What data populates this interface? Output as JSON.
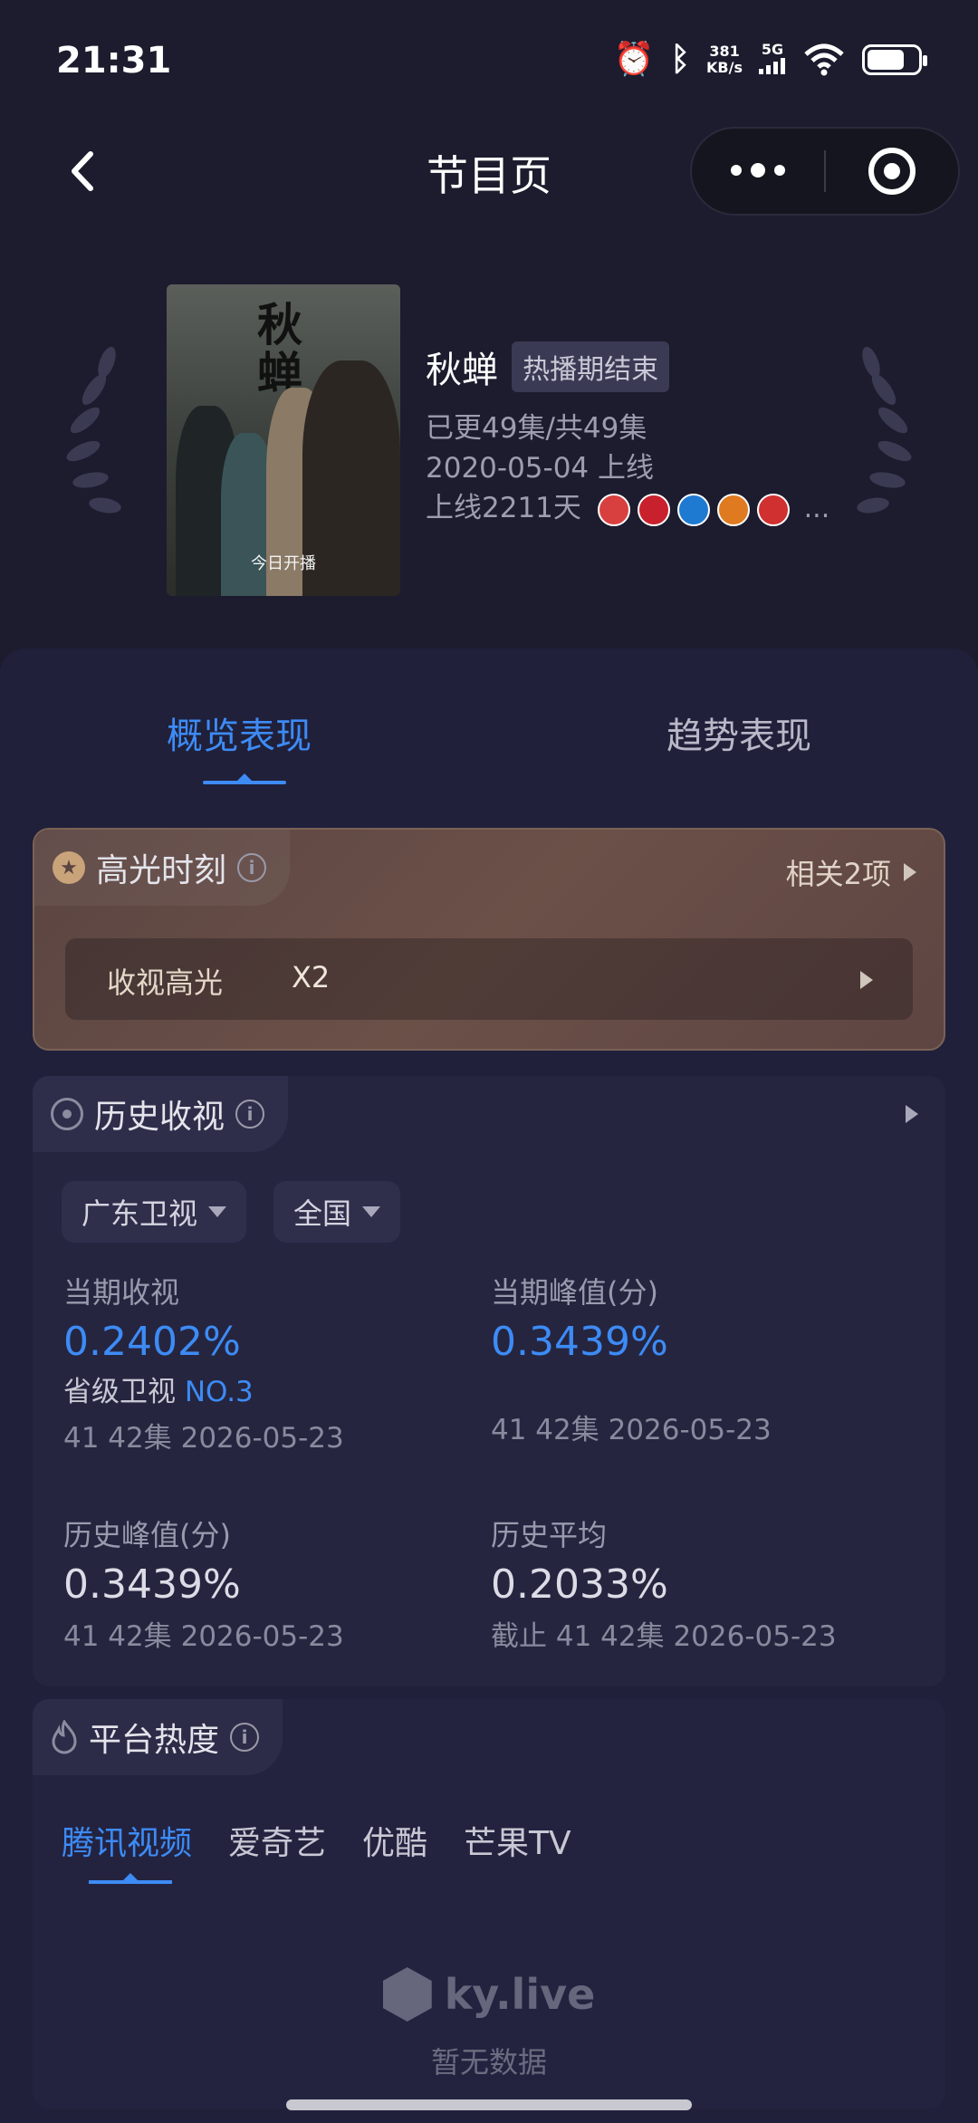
{
  "status_bar": {
    "time": "21:31",
    "speed_top": "381",
    "speed_bottom": "KB/s",
    "network": "5G"
  },
  "header": {
    "title": "节目页"
  },
  "program": {
    "title": "秋蝉",
    "status_tag": "热播期结束",
    "episodes": "已更49集/共49集",
    "release": "2020-05-04 上线",
    "days_online": "上线2211天",
    "more_channels": "...",
    "poster_title": "秋蝉",
    "poster_caption": "今日开播",
    "channel_colors": [
      "#d84040",
      "#c8202c",
      "#1e7ad0",
      "#e07a20",
      "#d03030"
    ]
  },
  "tabs": {
    "overview": "概览表现",
    "trend": "趋势表现"
  },
  "highlight": {
    "title": "高光时刻",
    "related": "相关2项",
    "row_label": "收视高光",
    "row_value": "X2"
  },
  "history": {
    "title": "历史收视",
    "filter_channel": "广东卫视",
    "filter_region": "全国",
    "current": {
      "label": "当期收视",
      "value": "0.2402%",
      "rank_label": "省级卫视",
      "rank": "NO.3",
      "sub": "41 42集 2026-05-23"
    },
    "current_peak": {
      "label": "当期峰值(分)",
      "value": "0.3439%",
      "sub": "41 42集 2026-05-23"
    },
    "hist_peak": {
      "label": "历史峰值(分)",
      "value": "0.3439%",
      "sub": "41 42集 2026-05-23"
    },
    "hist_avg": {
      "label": "历史平均",
      "value": "0.2033%",
      "sub": "截止 41 42集 2026-05-23"
    }
  },
  "platform": {
    "title": "平台热度",
    "tabs": [
      "腾讯视频",
      "爱奇艺",
      "优酷",
      "芒果TV"
    ],
    "brand": "ky.live",
    "empty": "暂无数据"
  }
}
